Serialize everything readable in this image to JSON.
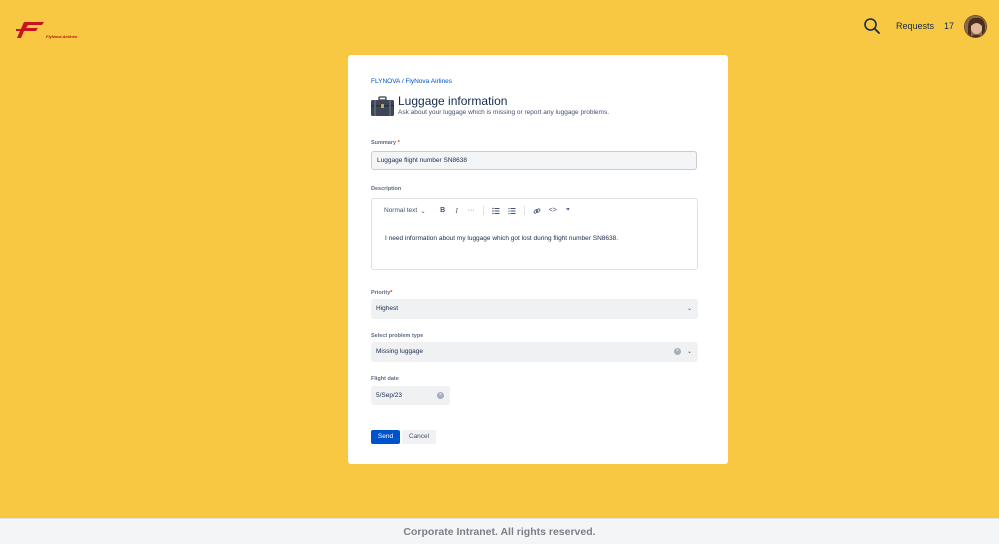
{
  "brand": {
    "logo_text": "FlyNova Airlines"
  },
  "topbar": {
    "requests_label": "Requests",
    "requests_count": "17"
  },
  "breadcrumb": {
    "org": "FLYNOVA",
    "separator": " / ",
    "project": "FlyNova Airlines"
  },
  "header": {
    "title": "Luggage information",
    "subtitle": "Ask about your luggage which is missing or report any luggage problems."
  },
  "form": {
    "summary": {
      "label": "Summary",
      "required_mark": "*",
      "value": "Luggage flight number SN8638"
    },
    "description": {
      "label": "Description",
      "toolbar": {
        "text_style": "Normal text",
        "bold": "B",
        "italic": "I",
        "more": "···",
        "bullet_list": "☰",
        "numbered_list": "☷",
        "link": "🔗",
        "code": "<>",
        "quote": "❞"
      },
      "value": "I need information about my luggage which got lost during flight number SN8638."
    },
    "priority": {
      "label": "Priority",
      "required_mark": "*",
      "value": "Highest"
    },
    "problem_type": {
      "label": "Select problem type",
      "value": "Missing luggage"
    },
    "flight_date": {
      "label": "Flight date",
      "value": "5/Sep/23"
    }
  },
  "actions": {
    "send": "Send",
    "cancel": "Cancel"
  },
  "footer": {
    "text": "Corporate Intranet. All rights reserved."
  },
  "colors": {
    "background": "#f8c843",
    "primary": "#0052cc",
    "brand_red": "#c8121e"
  }
}
